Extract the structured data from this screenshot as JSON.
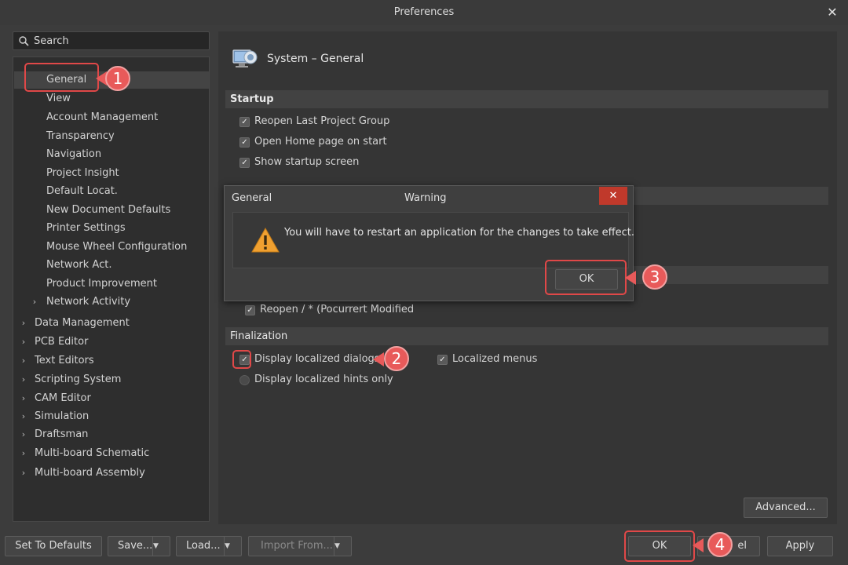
{
  "window": {
    "title": "Preferences",
    "close_label": "✕"
  },
  "search": {
    "placeholder": "Search"
  },
  "tree": {
    "general_items": [
      "General",
      "View",
      "Account Management",
      "Transparency",
      "Navigation",
      "Project Insight",
      "Default Locat.",
      "New Document Defaults",
      "Printer Settings",
      "Mouse Wheel Configuration",
      "Network Act.",
      "Product Improvement"
    ],
    "network_activity": "Network Activity",
    "categories": [
      "Data Management",
      "PCB Editor",
      "Text Editors",
      "Scripting System",
      "CAM Editor",
      "Simulation",
      "Draftsman",
      "Multi-board Schematic",
      "Multi-board Assembly"
    ]
  },
  "header": {
    "title": "System – General",
    "icon": "computer-icon"
  },
  "startup": {
    "title": "Startup",
    "options": [
      "Reopen Last Project Group",
      "Open Home page on start",
      "Show startup screen"
    ]
  },
  "hidden_row": {
    "label": "Reopen / * (Pocurrert Modified"
  },
  "finalization": {
    "title": "Finalization",
    "localized_dialogs": "Display localized dialogs",
    "localized_menus": "Localized menus",
    "hints_only": "Display localized hints only"
  },
  "dialog": {
    "left_title": "General",
    "title": "Warning",
    "close_label": "✕",
    "message": "You will have to restart an application for the changes to take effect.",
    "ok_label": "OK"
  },
  "buttons": {
    "advanced": "Advanced...",
    "set_defaults": "Set To Defaults",
    "save": "Save...",
    "load": "Load...",
    "import": "Import From...",
    "ok": "OK",
    "cancel_partial": "el",
    "apply": "Apply"
  },
  "callouts": [
    "1",
    "2",
    "3",
    "4"
  ],
  "colors": {
    "callout": "#e04848",
    "badge": "#e85a5a",
    "dialog_close": "#c0392b"
  }
}
